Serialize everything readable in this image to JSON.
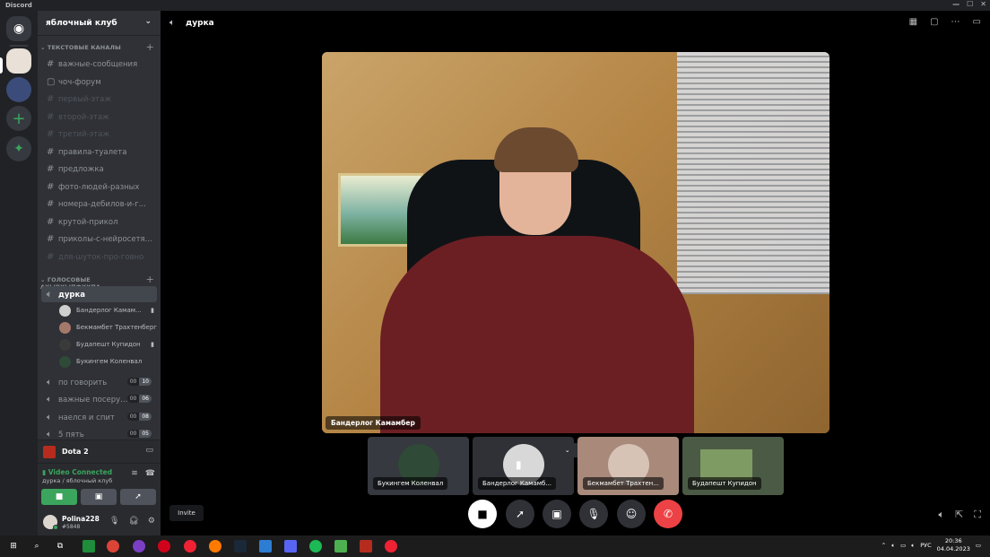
{
  "app": {
    "title": "Discord"
  },
  "window_controls": {
    "minimize": "—",
    "maximize": "☐",
    "close": "✕"
  },
  "server": {
    "name": "яблочный клуб"
  },
  "categories": {
    "text": "ТЕКСТОВЫЕ КАНАЛЫ",
    "voice": "ГОЛОСОВЫЕ АХЫВХЫПФХХПА..."
  },
  "text_channels": [
    {
      "name": "важные-сообщения",
      "muted": false,
      "icon": "#"
    },
    {
      "name": "чоч-форум",
      "muted": false,
      "icon": "forum"
    },
    {
      "name": "первый-этаж",
      "muted": true,
      "icon": "#"
    },
    {
      "name": "второй-этаж",
      "muted": true,
      "icon": "#"
    },
    {
      "name": "третий-этаж",
      "muted": true,
      "icon": "#"
    },
    {
      "name": "правила-туалета",
      "muted": false,
      "icon": "#"
    },
    {
      "name": "предложка",
      "muted": false,
      "icon": "#"
    },
    {
      "name": "фото-людей-разных",
      "muted": false,
      "icon": "#"
    },
    {
      "name": "номера-дебилов-и-г...",
      "muted": false,
      "icon": "#"
    },
    {
      "name": "крутой-прикол",
      "muted": false,
      "icon": "#"
    },
    {
      "name": "приколы-с-нейросетя...",
      "muted": false,
      "icon": "#"
    },
    {
      "name": "для-шуток-про-говно",
      "muted": true,
      "icon": "#"
    }
  ],
  "voice_channels": {
    "active": "дурка",
    "members": [
      {
        "name": "Бандерлог Камам...",
        "camera": true
      },
      {
        "name": "Бекмамбет Трахтенберг",
        "camera": false
      },
      {
        "name": "Будапешт Купидон",
        "camera": true
      },
      {
        "name": "Букингем Коленвал",
        "camera": false
      }
    ],
    "others": [
      {
        "name": "по говорить",
        "count_a": "00",
        "count_b": "10"
      },
      {
        "name": "важные посеру...",
        "count_a": "00",
        "count_b": "06"
      },
      {
        "name": "наелся и спит",
        "count_a": "00",
        "count_b": "08"
      },
      {
        "name": "5 пять",
        "count_a": "00",
        "count_b": "05"
      }
    ]
  },
  "game_activity": {
    "name": "Dota 2"
  },
  "voice_panel": {
    "status": "Video Connected",
    "location": "дурка / яблочный клуб"
  },
  "user": {
    "name": "Polina228",
    "tag": "#5848"
  },
  "tooltip": {
    "text": "Invite"
  },
  "main": {
    "channel_title": "дурка",
    "stage_name": "Бандерлог Камамбер",
    "tiles": [
      {
        "name": "Букингем Коленвал"
      },
      {
        "name": "Бандерлог Камамб..."
      },
      {
        "name": "Бекмамбет Трахтен..."
      },
      {
        "name": "Будапешт Купидон"
      }
    ]
  },
  "taskbar": {
    "lang": "РУС",
    "time": "20:36",
    "date": "04.04.2023"
  },
  "colors": {
    "green": "#3ba55d",
    "red": "#ed4245",
    "bg_dark": "#202225",
    "sidebar": "#2f3136"
  }
}
